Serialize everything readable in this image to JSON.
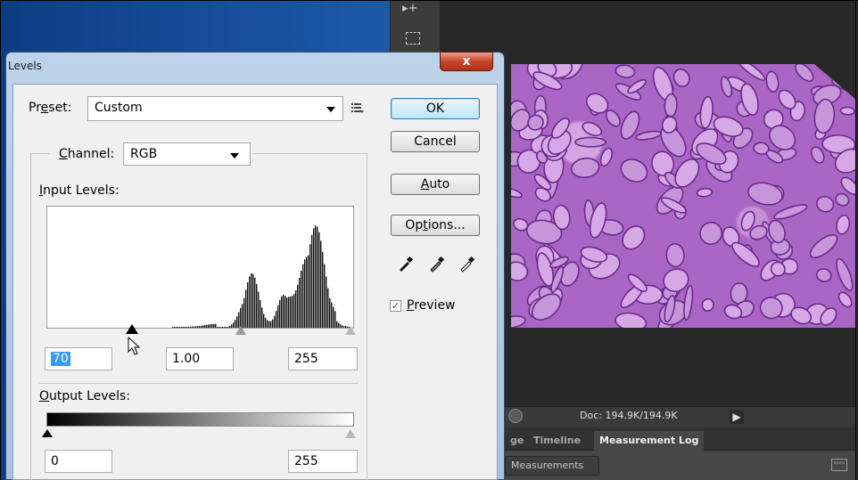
{
  "dialog": {
    "title": "Levels",
    "close_label": "x",
    "preset_label_pre": "Pr",
    "preset_label_u": "e",
    "preset_label_post": "set:",
    "preset_value": "Custom",
    "channel_label_u": "C",
    "channel_label_post": "hannel:",
    "channel_value": "RGB",
    "input_levels_u": "I",
    "input_levels_post": "nput Levels:",
    "input_black": "70",
    "input_gamma": "1.00",
    "input_white": "255",
    "output_levels_u": "O",
    "output_levels_post": "utput Levels:",
    "output_black": "0",
    "output_white": "255",
    "buttons": {
      "ok": "OK",
      "cancel": "Cancel",
      "auto_u": "A",
      "auto_post": "uto",
      "options_pre": "Op",
      "options_u": "t",
      "options_post": "ions..."
    },
    "preview_check": "✓",
    "preview_u": "P",
    "preview_post": "review",
    "preview_checked": true
  },
  "photoshop": {
    "doc_status": "Doc: 194.9K/194.9K",
    "play_glyph": "▶",
    "tabs": [
      "ge",
      "Timeline",
      "Measurement Log"
    ],
    "active_tab": "Measurement Log",
    "measurements_button": "Measurements",
    "ruler_glyph": "ᴹᴹᴹ",
    "move_tool_glyph": "▸+"
  },
  "colors": {
    "tissue": "#a966c4",
    "ps_dark": "#282828",
    "desktop_blue": "#174f9c"
  }
}
